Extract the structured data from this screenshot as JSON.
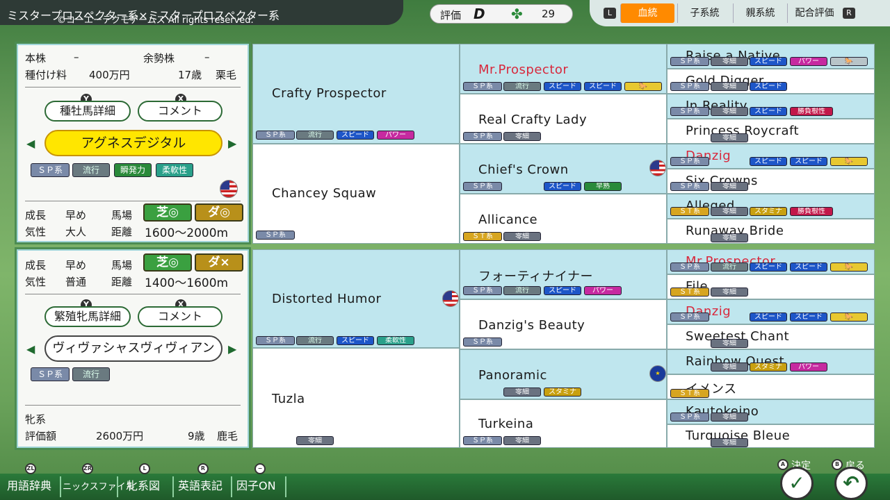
{
  "header": {
    "title": "ミスタープロスペクター系×ミスタープロスペクター系",
    "copyright": "©コーエーテクモゲームス All rights reserved.",
    "eval_label": "評価",
    "eval_grade": "D",
    "clover_icon": "clover-icon",
    "eval_score": "29"
  },
  "tabs": [
    {
      "key": "L",
      "label": "血統"
    },
    {
      "label": "子系統"
    },
    {
      "label": "親系統"
    },
    {
      "label": "配合評価",
      "key": "R"
    }
  ],
  "sire": {
    "labels": {
      "stock": "本株",
      "stock_v": "–",
      "vigor": "余勢株",
      "vigor_v": "–",
      "fee_label": "種付け料",
      "fee": "400万円",
      "age": "17歳",
      "color": "栗毛"
    },
    "detail_btn": "種牡馬詳細",
    "detail_key": "Y",
    "comment_btn": "コメント",
    "comment_key": "X",
    "name": "アグネスデジタル",
    "tags": [
      "ＳＰ系",
      "流行",
      "瞬発力",
      "柔軟性"
    ],
    "growth_label": "成長",
    "growth": "早め",
    "track_label": "馬場",
    "turf": "芝◎",
    "dirt": "ダ◎",
    "temper_label": "気性",
    "temper": "大人",
    "dist_label": "距離",
    "dist": "1600〜2000m"
  },
  "dam": {
    "growth_label": "成長",
    "growth": "早め",
    "track_label": "馬場",
    "turf": "芝◎",
    "dirt": "ダ×",
    "temper_label": "気性",
    "temper": "普通",
    "dist_label": "距離",
    "dist": "1400〜1600m",
    "detail_btn": "繁殖牝馬詳細",
    "detail_key": "Y",
    "comment_btn": "コメント",
    "comment_key": "X",
    "name": "ヴィヴァシャスヴィヴィアン",
    "tags": [
      "ＳＰ系",
      "流行"
    ],
    "line_label": "牝系",
    "value_label": "評価額",
    "value": "2600万円",
    "age": "9歳",
    "color": "鹿毛"
  },
  "pedigree": {
    "g1": [
      {
        "name": "Crafty Prospector",
        "tags": [
          "ＳＰ系",
          "流行",
          "スピード",
          "パワー"
        ]
      },
      {
        "name": "Chancey Squaw",
        "tags": [
          "ＳＰ系"
        ]
      },
      {
        "name": "Distorted Humor",
        "tags": [
          "ＳＰ系",
          "流行",
          "スピード",
          "柔軟性"
        ]
      },
      {
        "name": "Tuzla",
        "tags": [
          "零細"
        ]
      }
    ],
    "g2": [
      {
        "name": "Mr.Prospector",
        "tags": [
          "ＳＰ系",
          "流行",
          "スピード",
          "スピード"
        ]
      },
      {
        "name": "Real Crafty Lady",
        "tags": [
          "ＳＰ系",
          "零細"
        ]
      },
      {
        "name": "Chief's Crown",
        "tags": [
          "ＳＰ系",
          "スピード",
          "早熟"
        ]
      },
      {
        "name": "Allicance",
        "tags": [
          "ＳＴ系",
          "零細"
        ]
      },
      {
        "name": "フォーティナイナー",
        "tags": [
          "ＳＰ系",
          "流行",
          "スピード",
          "パワー"
        ]
      },
      {
        "name": "Danzig's Beauty",
        "tags": [
          "ＳＰ系"
        ]
      },
      {
        "name": "Panoramic",
        "tags": [
          "零細",
          "スタミナ"
        ]
      },
      {
        "name": "Turkeina",
        "tags": [
          "ＳＰ系",
          "零細"
        ]
      }
    ],
    "g3": [
      {
        "name": "Raise a Native",
        "tags": [
          "ＳＰ系",
          "零細",
          "スピード",
          "パワー"
        ]
      },
      {
        "name": "Gold Digger",
        "tags": [
          "ＳＰ系",
          "零細",
          "スピード"
        ]
      },
      {
        "name": "In Reality",
        "tags": [
          "ＳＰ系",
          "零細",
          "スピード",
          "勝負根性"
        ]
      },
      {
        "name": "Princess Roycraft",
        "tags": [
          "零細"
        ]
      },
      {
        "name": "Danzig",
        "tags": [
          "ＳＰ系",
          "スピード",
          "スピード"
        ]
      },
      {
        "name": "Six Crowns",
        "tags": [
          "ＳＰ系",
          "零細"
        ]
      },
      {
        "name": "Alleged",
        "tags": [
          "ＳＴ系",
          "零細",
          "スタミナ",
          "勝負根性"
        ]
      },
      {
        "name": "Runaway Bride",
        "tags": [
          "零細"
        ]
      },
      {
        "name": "Mr.Prospector",
        "tags": [
          "ＳＰ系",
          "流行",
          "スピード",
          "スピード"
        ]
      },
      {
        "name": "File",
        "tags": [
          "ＳＴ系",
          "零細"
        ]
      },
      {
        "name": "Danzig",
        "tags": [
          "ＳＰ系",
          "スピード",
          "スピード"
        ]
      },
      {
        "name": "Sweetest Chant",
        "tags": [
          "零細"
        ]
      },
      {
        "name": "Rainbow Quest",
        "tags": [
          "零細",
          "スタミナ",
          "パワー"
        ]
      },
      {
        "name": "イメンス",
        "tags": [
          "ＳＴ系"
        ]
      },
      {
        "name": "Kautokeino",
        "tags": [
          "ＳＰ系",
          "零細"
        ]
      },
      {
        "name": "Turquoise Bleue",
        "tags": [
          "零細"
        ]
      }
    ]
  },
  "bottom": {
    "items": [
      {
        "key": "ZL",
        "label": "用語辞典"
      },
      {
        "key": "ZR",
        "label": "ニックスファイル"
      },
      {
        "key": "L",
        "label": "牝系図"
      },
      {
        "key": "R",
        "label": "英語表記"
      },
      {
        "key": "−",
        "label": "因子ON"
      }
    ],
    "confirm": "決定",
    "confirm_key": "A",
    "back": "戻る",
    "back_key": "B"
  },
  "colors": {
    "accent_tab": "#ff8a00",
    "name_yellow": "#ffe600",
    "track_green": "#3aa040",
    "track_gold": "#b8901a",
    "blue_cell": "#bfe6ee"
  }
}
